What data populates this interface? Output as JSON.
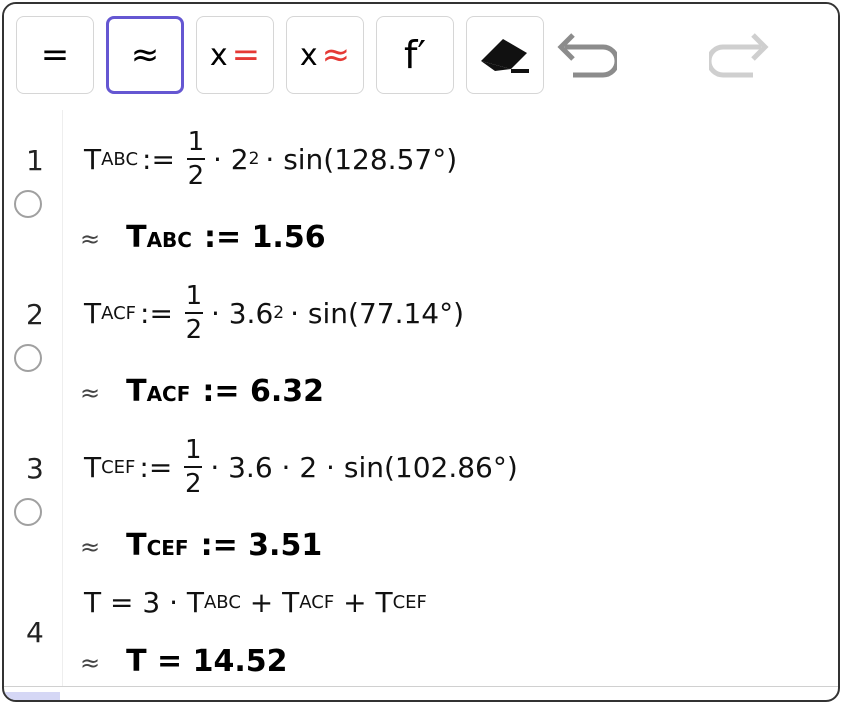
{
  "toolbar": {
    "exact_label": "=",
    "numeric_label": "≈",
    "solve_exact_x": "x",
    "solve_exact_sym": "=",
    "solve_numeric_x": "x",
    "solve_numeric_sym": "≈",
    "derivative_label": "f′",
    "accent_color": "#6557d2",
    "icons": [
      "eraser-icon",
      "undo-icon",
      "redo-icon"
    ]
  },
  "rows": [
    {
      "num": "1",
      "lhs_main": "T",
      "lhs_sub": "ABC",
      "assign": ":=",
      "frac_num": "1",
      "frac_den": "2",
      "rest1": "· 2",
      "rest1_sup": "2",
      "rest2": "· sin(128.57°)",
      "result_main": "T",
      "result_sub": "ABC",
      "result_rest": ":= 1.56"
    },
    {
      "num": "2",
      "lhs_main": "T",
      "lhs_sub": "ACF",
      "assign": ":=",
      "frac_num": "1",
      "frac_den": "2",
      "rest1": "· 3.6",
      "rest1_sup": "2",
      "rest2": "· sin(77.14°)",
      "result_main": "T",
      "result_sub": "ACF",
      "result_rest": ":= 6.32"
    },
    {
      "num": "3",
      "lhs_main": "T",
      "lhs_sub": "CEF",
      "assign": ":=",
      "frac_num": "1",
      "frac_den": "2",
      "rest1": "· 3.6 · 2 · sin(102.86°)",
      "result_main": "T",
      "result_sub": "CEF",
      "result_rest": ":= 3.51"
    },
    {
      "num": "4",
      "expr_a": "T  =  3 · T",
      "sub_a": "ABC",
      "expr_b": " + T",
      "sub_b": "ACF",
      "expr_c": " + T",
      "sub_c": "CEF",
      "result_text": "T = 14.52"
    }
  ],
  "approx_symbol": "≈"
}
